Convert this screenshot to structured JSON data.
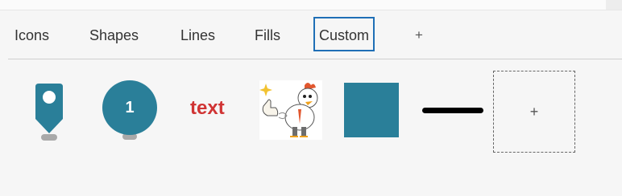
{
  "tabs": [
    {
      "label": "Icons"
    },
    {
      "label": "Shapes"
    },
    {
      "label": "Lines"
    },
    {
      "label": "Fills"
    },
    {
      "label": "Custom",
      "active": true
    },
    {
      "label": "+"
    }
  ],
  "items": {
    "marker_icon": {
      "icon": "map-marker-icon"
    },
    "numbered_circle": {
      "number": "1"
    },
    "text_item": {
      "label": "text"
    },
    "image_item": {
      "icon": "chicken-cartoon-image"
    },
    "square_fill": {
      "color": "#2a7f99"
    },
    "line_item": {
      "color": "#000000"
    },
    "add_custom": {
      "label": "+"
    }
  },
  "colors": {
    "accent": "#2a7f99",
    "active_tab_border": "#1f6fb6",
    "text_red": "#d03434"
  }
}
